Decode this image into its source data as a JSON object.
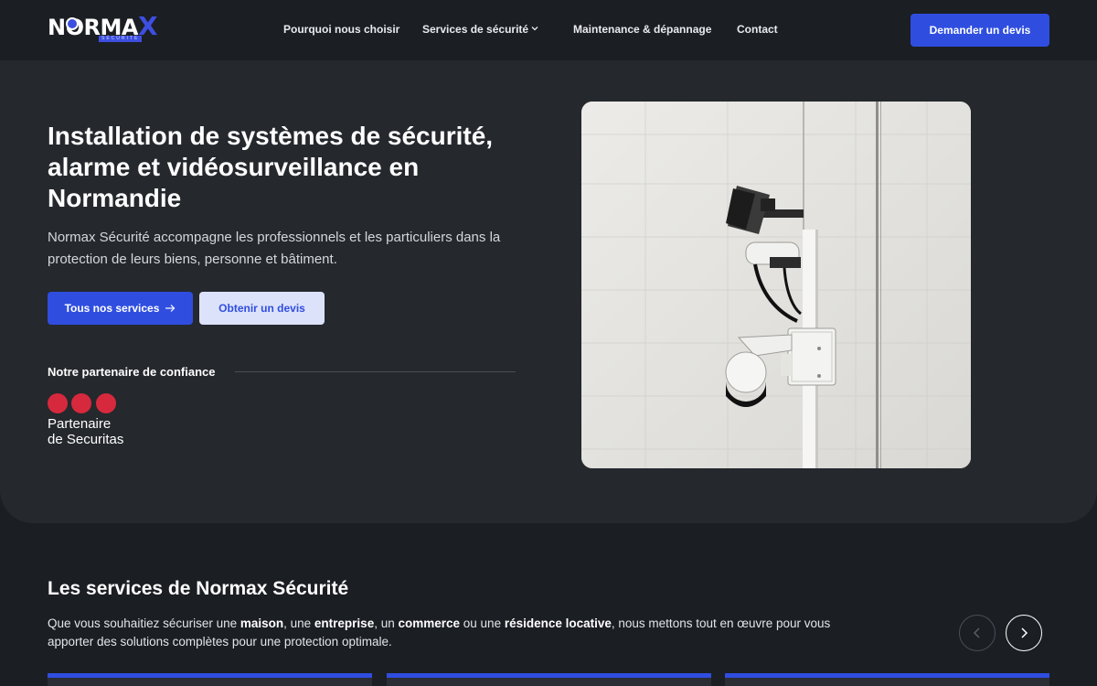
{
  "header": {
    "logo_text_main": "NORMA",
    "logo_text_x": "X",
    "logo_sub": "SÉCURITÉ",
    "nav": [
      {
        "label": "Pourquoi nous choisir"
      },
      {
        "label": "Services de sécurité"
      },
      {
        "label": "Maintenance & dépannage"
      },
      {
        "label": "Contact"
      }
    ],
    "cta_label": "Demander un devis"
  },
  "hero": {
    "title": "Installation de systèmes de sécurité, alarme et vidéosurveillance en Normandie",
    "description": "Normax Sécurité accompagne les professionnels et les particuliers dans la protection de leurs biens, personne et bâtiment.",
    "primary_button": "Tous nos services",
    "primary_button_arrow": "→",
    "secondary_button": "Obtenir un devis",
    "partner_label": "Notre partenaire de confiance",
    "partner_line1": "Partenaire",
    "partner_line2": "de Securitas"
  },
  "services": {
    "title": "Les services de Normax Sécurité",
    "desc_parts": [
      "Que vous souhaitiez sécuriser une ",
      "maison",
      ", une ",
      "entreprise",
      ", un ",
      "commerce",
      " ou une ",
      "résidence locative",
      ", nous mettons tout en œuvre pour vous apporter des solutions complètes pour une protection optimale."
    ]
  },
  "colors": {
    "accent": "#2f4ee0",
    "background": "#1b1e23",
    "hero_bg": "#25282d",
    "securitas_red": "#d6293d"
  },
  "icons": {
    "chevron": "chevron-down-icon",
    "arrow": "arrow-right-icon",
    "prev": "chevron-left-icon",
    "next": "chevron-right-icon"
  }
}
